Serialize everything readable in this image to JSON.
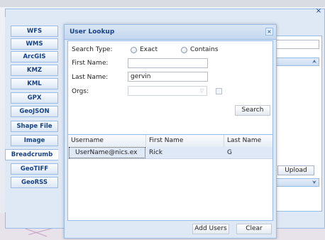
{
  "outer_window": {
    "close_glyph": "×"
  },
  "tabs": [
    {
      "label": "WFS"
    },
    {
      "label": "WMS"
    },
    {
      "label": "ArcGIS"
    },
    {
      "label": "KMZ"
    },
    {
      "label": "KML"
    },
    {
      "label": "GPX"
    },
    {
      "label": "GeoJSON"
    },
    {
      "label": "Shape File"
    },
    {
      "label": "Image"
    },
    {
      "label": "Breadcrumb",
      "active": true
    },
    {
      "label": "GeoTIFF"
    },
    {
      "label": "GeoRSS"
    }
  ],
  "right_panel": {
    "upload_label": "Upload",
    "collapse_glyph": "⮝",
    "expand_glyph": "⮟"
  },
  "dialog": {
    "title": "User Lookup",
    "close_glyph": "×",
    "search_type_label": "Search Type:",
    "exact_label": "Exact",
    "contains_label": "Contains",
    "first_name_label": "First Name:",
    "first_name_value": "",
    "last_name_label": "Last Name:",
    "last_name_value": "gervin",
    "orgs_label": "Orgs:",
    "orgs_value": "",
    "search_button": "Search",
    "grid": {
      "columns": [
        "Username",
        "First Name",
        "Last Name"
      ],
      "rows": [
        [
          "UserName@nics.ex",
          "Rick",
          "G"
        ]
      ]
    },
    "add_users_button": "Add Users",
    "clear_button": "Clear"
  }
}
